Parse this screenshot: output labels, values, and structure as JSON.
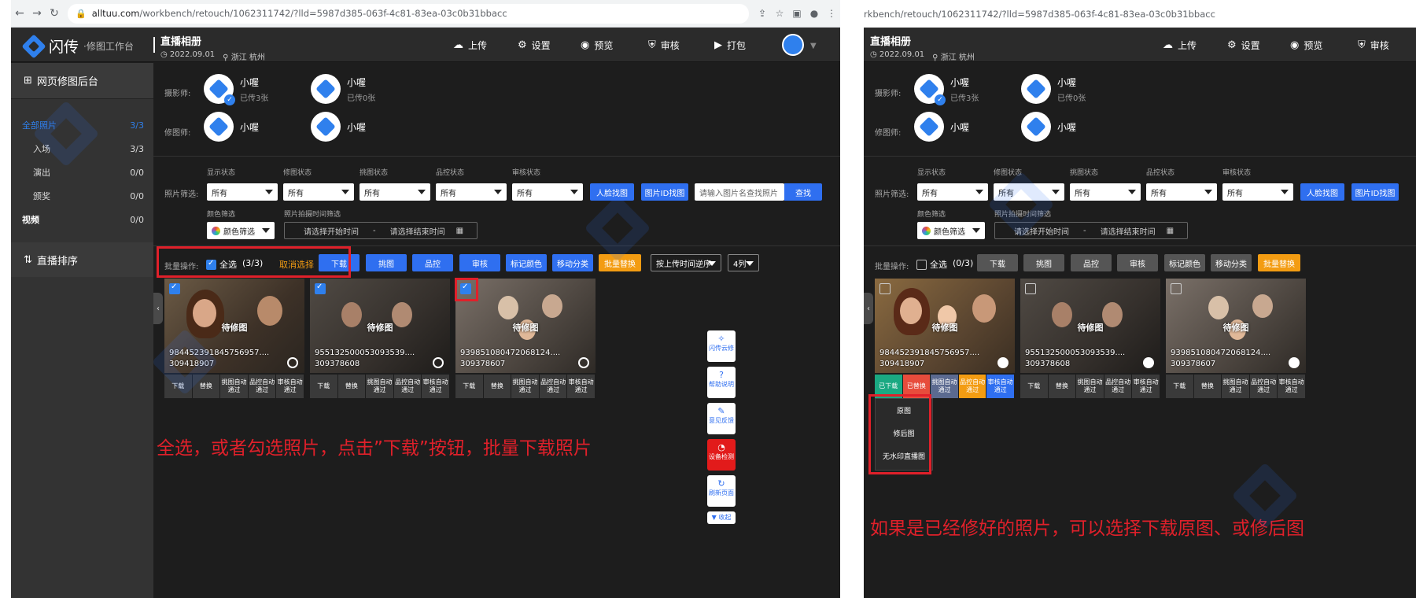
{
  "left": {
    "browser": {
      "domain": "alltuu.com",
      "path": "/workbench/retouch/1062311742/?lld=5987d385-063f-4c81-83ea-03c0b31bbacc"
    },
    "header": {
      "brand": "闪传",
      "sub": "·修图工作台",
      "event_title": "直播相册",
      "event_date": "2022.09.01",
      "event_location": "浙江 杭州",
      "buttons": [
        "上传",
        "设置",
        "预览",
        "审核",
        "打包"
      ]
    },
    "sidebar": {
      "title": "网页修图后台",
      "items": [
        {
          "label": "全部照片",
          "count": "3/3"
        },
        {
          "label": "入场",
          "count": "3/3"
        },
        {
          "label": "演出",
          "count": "0/0"
        },
        {
          "label": "颁奖",
          "count": "0/0"
        },
        {
          "label": "视频",
          "count": "0/0"
        }
      ],
      "sort_label": "直播排序"
    },
    "photographers_label": "摄影师:",
    "retouchers_label": "修图师:",
    "photographers": [
      {
        "name": "小喔",
        "sub": "已传3张"
      },
      {
        "name": "小喔",
        "sub": "已传0张"
      }
    ],
    "retouchers": [
      {
        "name": "小喔"
      },
      {
        "name": "小喔"
      }
    ],
    "filter": {
      "label": "照片筛选:",
      "col_labels": [
        "显示状态",
        "修图状态",
        "挑图状态",
        "品控状态",
        "审核状态"
      ],
      "value": "所有",
      "face_btn": "人脸找图",
      "id_btn": "图片ID找图",
      "search_placeholder": "请输入图片名查找照片",
      "search_btn": "查找",
      "color_label": "颜色筛选",
      "time_label": "照片拍摄时间筛选",
      "color_value": "颜色筛选",
      "start_time": "请选择开始时间",
      "dash": "-",
      "end_time": "请选择结束时间"
    },
    "batch": {
      "label": "批量操作:",
      "select_all": "全选",
      "count": "(3/3)",
      "cancel": "取消选择",
      "download": "下载",
      "buttons": [
        "挑图",
        "品控",
        "审核",
        "标记颜色",
        "移动分类"
      ],
      "replace": "批量替换",
      "sort": "按上传时间逆序",
      "cols": "4列"
    },
    "photos": [
      {
        "status": "待修图",
        "fn1": "984452391845756957....",
        "fn2": "309418907"
      },
      {
        "status": "待修图",
        "fn1": "955132500053093539....",
        "fn2": "309378608"
      },
      {
        "status": "待修图",
        "fn1": "939851080472068124....",
        "fn2": "309378607"
      }
    ],
    "ops": [
      "下载",
      "替换",
      "挑图自动通过",
      "品控自动通过",
      "审核自动通过"
    ],
    "floats": [
      "闪传云修",
      "帮助说明",
      "意见反馈",
      "设备检测",
      "刷新页面",
      "收起"
    ],
    "annotation": "全选，或者勾选照片，点击”下载”按钮，批量下载照片"
  },
  "right": {
    "browser": {
      "path": "rkbench/retouch/1062311742/?lld=5987d385-063f-4c81-83ea-03c0b31bbacc"
    },
    "header": {
      "event_title": "直播相册",
      "event_date": "2022.09.01",
      "event_location": "浙江 杭州",
      "buttons": [
        "上传",
        "设置",
        "预览",
        "审核"
      ]
    },
    "photographers_label": "摄影师:",
    "retouchers_label": "修图师:",
    "photographers": [
      {
        "name": "小喔",
        "sub": "已传3张"
      },
      {
        "name": "小喔",
        "sub": "已传0张"
      }
    ],
    "retouchers": [
      {
        "name": "小喔"
      },
      {
        "name": "小喔"
      }
    ],
    "filter": {
      "label": "照片筛选:",
      "col_labels": [
        "显示状态",
        "修图状态",
        "挑图状态",
        "品控状态",
        "审核状态"
      ],
      "value": "所有",
      "face_btn": "人脸找图",
      "id_btn": "图片ID找图",
      "color_label": "颜色筛选",
      "time_label": "照片拍摄时间筛选",
      "color_value": "颜色筛选",
      "start_time": "请选择开始时间",
      "dash": "-",
      "end_time": "请选择结束时间"
    },
    "batch": {
      "label": "批量操作:",
      "select_all": "全选",
      "count": "(0/3)",
      "buttons": [
        "下载",
        "挑图",
        "品控",
        "审核",
        "标记颜色",
        "移动分类"
      ],
      "replace": "批量替换"
    },
    "photos": [
      {
        "status": "待修图",
        "fn1": "984452391845756957....",
        "fn2": "309418907"
      },
      {
        "status": "待修图",
        "fn1": "955132500053093539....",
        "fn2": "309378608"
      },
      {
        "status": "待修图",
        "fn1": "939851080472068124....",
        "fn2": "309378607"
      }
    ],
    "ops_first": [
      "已下载",
      "已替换",
      "挑图自动通过",
      "品控自动通过",
      "审核自动通过"
    ],
    "ops": [
      "下载",
      "替换",
      "挑图自动通过",
      "品控自动通过",
      "审核自动通过"
    ],
    "menu": [
      "原图",
      "修后图",
      "无水印直播图"
    ],
    "annotation": "如果是已经修好的照片，可以选择下载原图、或修后图"
  },
  "colors": {
    "accent": "#2f6ff0",
    "highlight": "#e0202a",
    "replace": "#f39c12"
  }
}
